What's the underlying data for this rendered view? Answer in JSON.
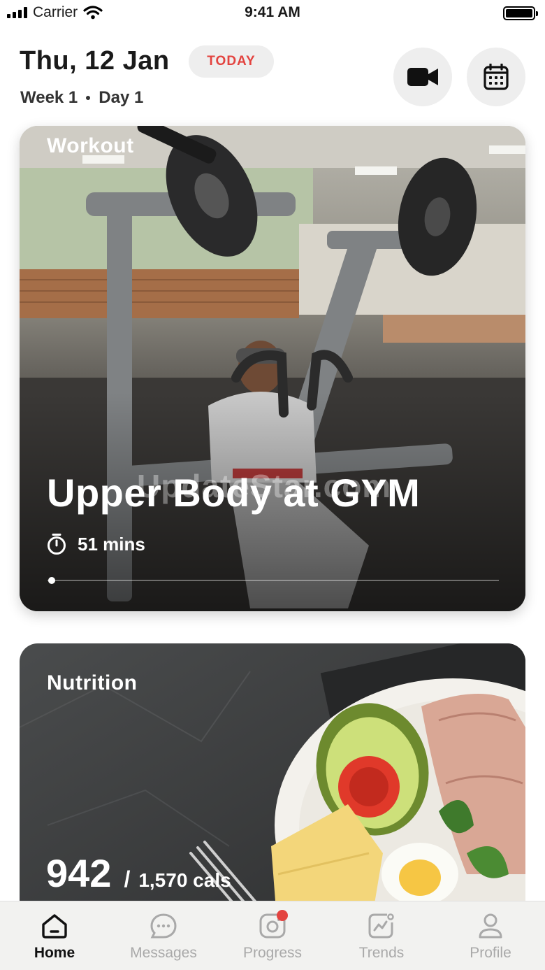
{
  "status_bar": {
    "carrier": "Carrier",
    "time": "9:41 AM"
  },
  "header": {
    "date": "Thu, 12 Jan",
    "today_badge": "TODAY",
    "week": "Week 1",
    "day": "Day 1"
  },
  "workout_card": {
    "label": "Workout",
    "title": "Upper Body at GYM",
    "duration": "51 mins",
    "progress": 0.01
  },
  "nutrition_card": {
    "label": "Nutrition",
    "calories_eaten": "942",
    "separator": "/",
    "calories_goal": "1,570 cals"
  },
  "watermark": "UpdateStar.com",
  "tab_bar": {
    "tabs": [
      {
        "label": "Home",
        "icon": "home-icon",
        "active": true
      },
      {
        "label": "Messages",
        "icon": "chat-icon",
        "active": false
      },
      {
        "label": "Progress",
        "icon": "camera-icon",
        "active": false,
        "badge": true
      },
      {
        "label": "Trends",
        "icon": "chart-icon",
        "active": false
      },
      {
        "label": "Profile",
        "icon": "user-icon",
        "active": false
      }
    ]
  },
  "colors": {
    "accent": "#e3433f",
    "active_tab": "#111111",
    "inactive_tab": "#a9a9a9"
  }
}
